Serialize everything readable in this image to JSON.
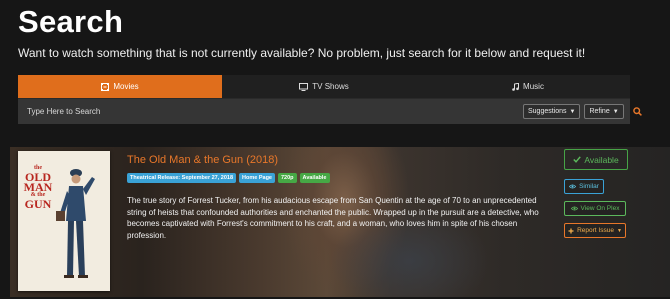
{
  "header": {
    "title": "Search",
    "subtitle": "Want to watch something that is not currently available? No problem, just search for it below and request it!"
  },
  "tabs": [
    {
      "label": "Movies",
      "icon": "film-icon",
      "active": true
    },
    {
      "label": "TV Shows",
      "icon": "tv-icon",
      "active": false
    },
    {
      "label": "Music",
      "icon": "music-note-icon",
      "active": false
    }
  ],
  "search": {
    "placeholder": "Type Here to Search",
    "value": "",
    "suggestions_label": "Suggestions",
    "refine_label": "Refine",
    "icon": "search-icon"
  },
  "result": {
    "poster": {
      "line1": "the",
      "line2": "OLD",
      "line3": "MAN",
      "line4": "& the",
      "line5": "GUN"
    },
    "title": "The Old Man & the Gun (2018)",
    "badges": [
      {
        "label": "Theatrical Release: September 27, 2018",
        "color": "#3aa2d6"
      },
      {
        "label": "Home Page",
        "color": "#3aa2d6"
      },
      {
        "label": "720p",
        "color": "#46a845"
      },
      {
        "label": "Available",
        "color": "#46a845"
      }
    ],
    "overview": "The true story of Forrest Tucker, from his audacious escape from San Quentin at the age of 70 to an unprecedented string of heists that confounded authorities and enchanted the public. Wrapped up in the pursuit are a detective, who becomes captivated with Forrest's commitment to his craft, and a woman, who loves him in spite of his chosen profession.",
    "actions": {
      "available_label": "Available",
      "similar_label": "Similar",
      "plex_label": "View On Plex",
      "report_label": "Report Issue"
    }
  },
  "colors": {
    "accent": "#e06e1c",
    "info": "#3aa2d6",
    "success": "#5cb85c",
    "warning": "#f0ad4e"
  }
}
